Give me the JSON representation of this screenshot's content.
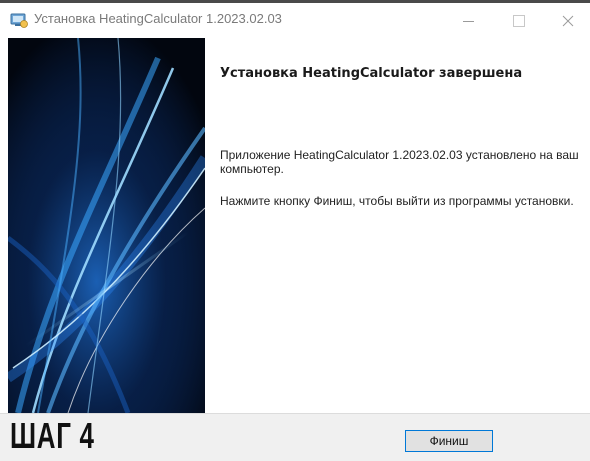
{
  "window": {
    "title": "Установка HeatingCalculator 1.2023.02.03"
  },
  "content": {
    "heading": "Установка HeatingCalculator завершена",
    "paragraph1": "Приложение HeatingCalculator 1.2023.02.03 установлено на ваш компьютер.",
    "paragraph2": "Нажмите кнопку Финиш, чтобы выйти из программы установки."
  },
  "footer": {
    "step_label": "ШАГ 4",
    "finish_label": "Финиш"
  },
  "icons": {
    "app": "installer-icon",
    "minimize": "minimize-icon",
    "maximize": "maximize-icon",
    "close": "close-icon"
  },
  "colors": {
    "accent": "#0078d7",
    "banner_background": "#02060f",
    "banner_glow": "#3aa8ff"
  }
}
